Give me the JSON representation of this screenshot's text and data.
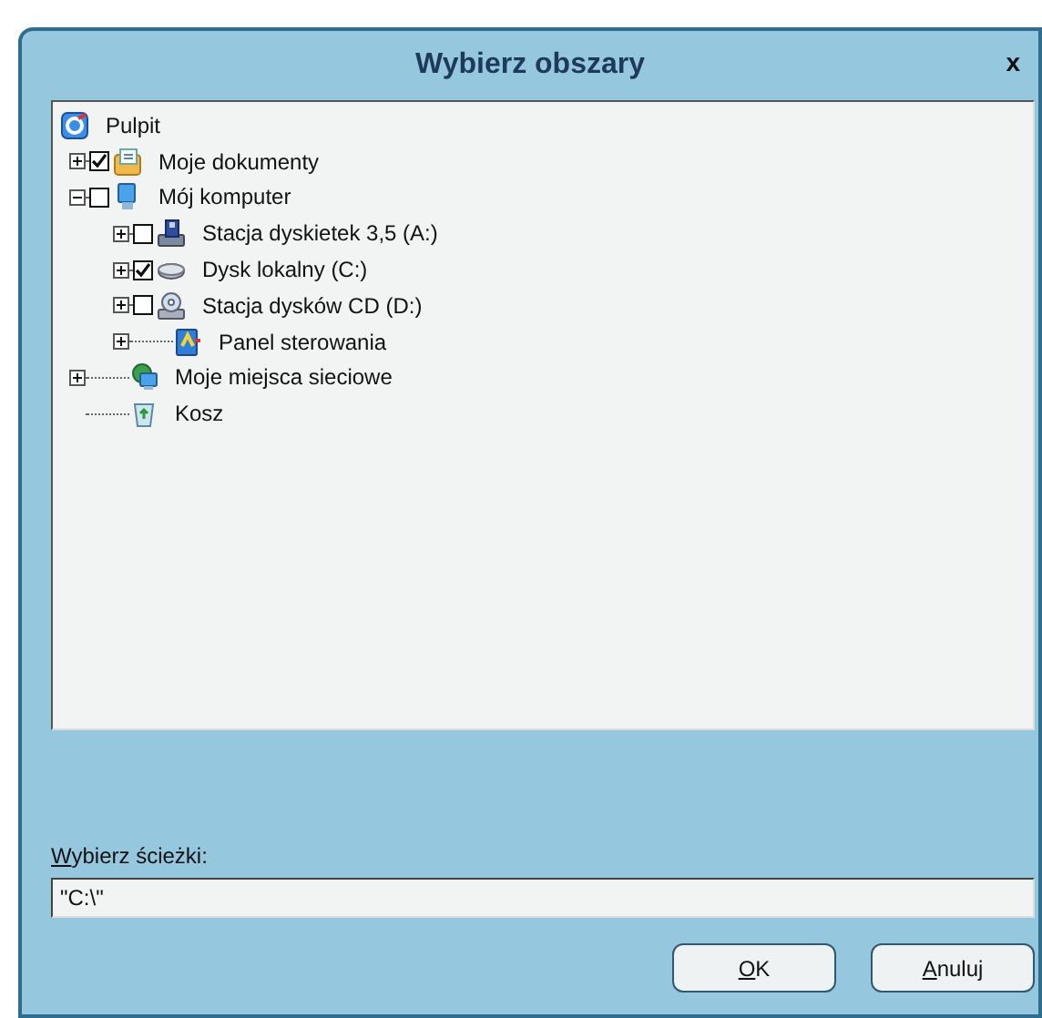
{
  "window": {
    "title": "Wybierz obszary",
    "close": "x"
  },
  "tree": {
    "label": "Pulpit",
    "kind": "desktop",
    "children": [
      {
        "label": "Moje dokumenty",
        "kind": "documents",
        "expanded": false,
        "checked": true
      },
      {
        "label": "Mój komputer",
        "kind": "computer",
        "expanded": true,
        "checked": false,
        "children": [
          {
            "label": "Stacja dyskietek 3,5 (A:)",
            "kind": "floppy",
            "expanded": false,
            "checked": false
          },
          {
            "label": "Dysk lokalny (C:)",
            "kind": "harddisk",
            "expanded": false,
            "checked": true
          },
          {
            "label": "Stacja dysków CD (D:)",
            "kind": "cdrom",
            "expanded": false,
            "checked": false
          },
          {
            "label": "Panel sterowania",
            "kind": "control-panel",
            "expanded": false
          }
        ]
      },
      {
        "label": "Moje miejsca sieciowe",
        "kind": "network",
        "expanded": false
      },
      {
        "label": "Kosz",
        "kind": "recycle-bin"
      }
    ]
  },
  "path_field": {
    "label": "Wybierz ścieżki:",
    "value": "\"C:\\\""
  },
  "buttons": [
    {
      "label": "OK"
    },
    {
      "label": "Anuluj"
    }
  ]
}
